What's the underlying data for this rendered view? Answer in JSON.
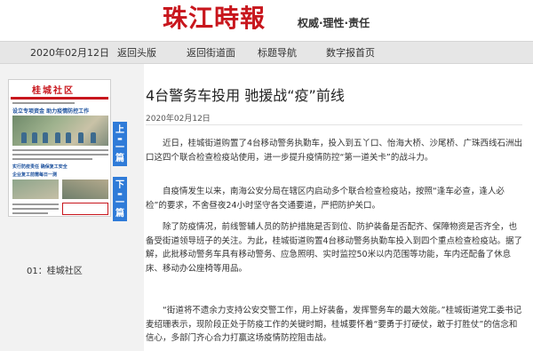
{
  "masthead": {
    "logo": "珠江時報",
    "slogan": "权威·理性·责任"
  },
  "nav": {
    "date": "2020年02月12日",
    "items": [
      "返回头版",
      "返回街道面",
      "标题导航",
      "数字报首页"
    ]
  },
  "thumbnail": {
    "title": "桂城社区",
    "headline": "设立专项资金 助力疫情防控工作",
    "sub1": "实行防疫责任 确保复工安全",
    "sub2": "企业复工前需每日一测",
    "caption": "01：桂城社区"
  },
  "page_tabs": {
    "prev": [
      "上",
      "一",
      "篇"
    ],
    "next": [
      "下",
      "一",
      "篇"
    ]
  },
  "article": {
    "title": "4台警务车投用 驰援战“疫”前线",
    "date": "2020年02月12日",
    "paragraphs": [
      "近日，桂城街道购置了4台移动警务执勤车，投入到五丫口、怡海大桥、沙尾桥、广珠西线石洲出口这四个联合检查检疫站使用，进一步提升疫情防控“第一道关卡”的战斗力。",
      "自疫情发生以来，南海公安分局在辖区内启动多个联合检查检疫站，按照“逢车必查，逢人必检”的要求，不舍昼夜24小时坚守各交通要道，严把防护关口。",
      "除了防疫情况，前线警辅人员的防护措施是否到位、防护装备是否配齐、保障物资是否齐全，也备受街道领导班子的关注。为此，桂城街道购置4台移动警务执勤车投入到四个重点检查检疫站。据了解，此批移动警务车具有移动警务、应急照明、实时监控50米以内范围等功能，车内还配备了休息床、移动办公座椅等用品。",
      "“街道将不遗余力支持公安交警工作，用上好装备，发挥警务车的最大效能。”桂城街道党工委书记麦绍珊表示，现阶段正处于防疫工作的关键时期，桂城要怀着“要勇于打硬仗，敢于打胜仗”的信念和信心，多部门齐心合力打赢这场疫情防控阻击战。"
    ]
  }
}
